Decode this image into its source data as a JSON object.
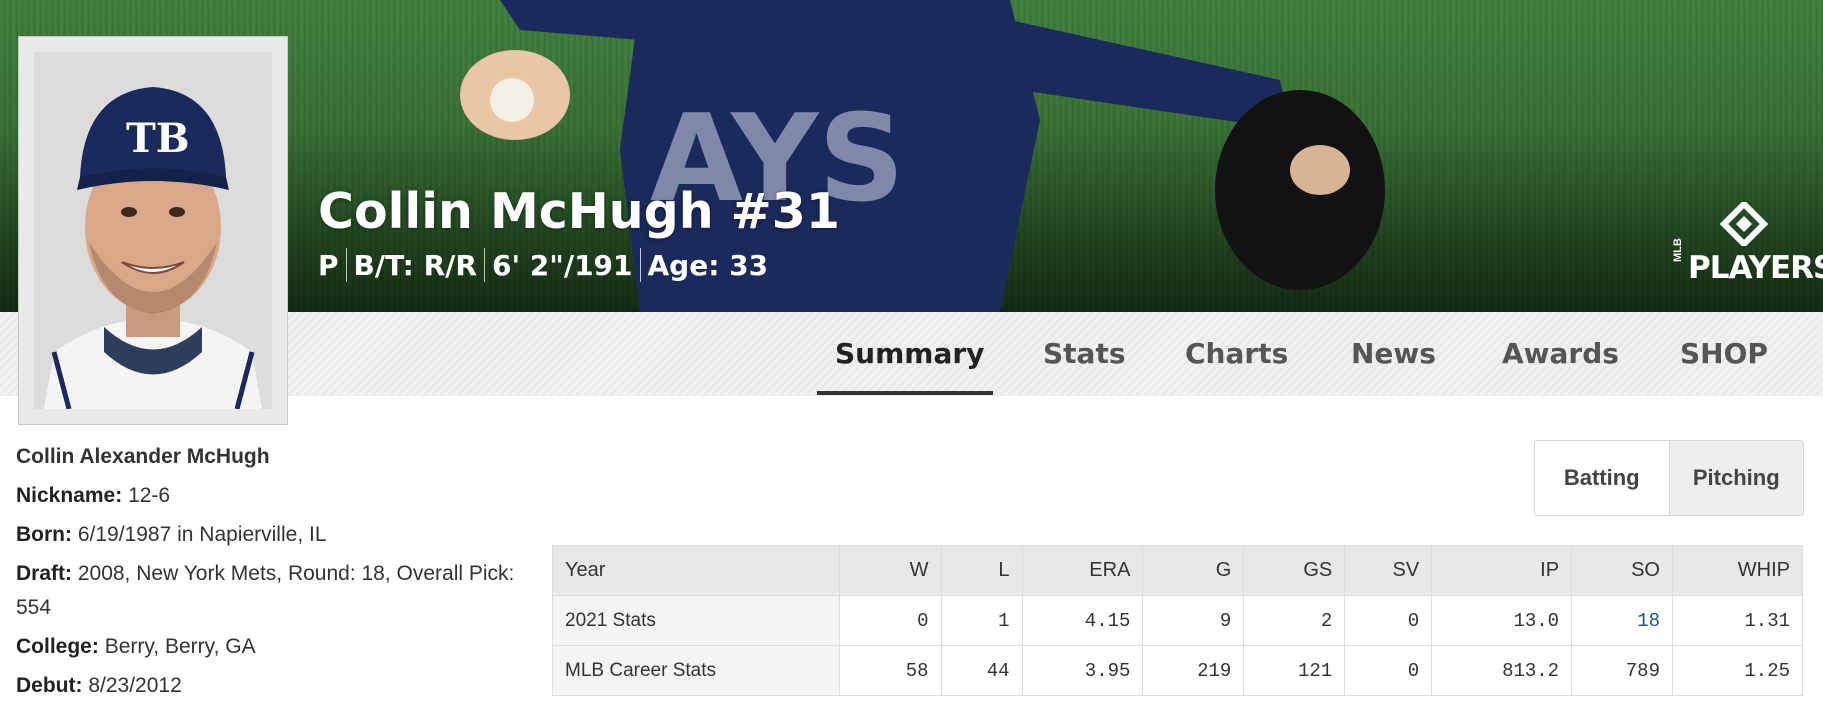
{
  "hero": {
    "name": "Collin McHugh #31",
    "vitals": [
      "P",
      "B/T: R/R",
      "6' 2\"/191",
      "Age: 33"
    ],
    "logo": {
      "small": "MLB",
      "main": "PLAYERS"
    }
  },
  "nav": {
    "tabs": [
      "Summary",
      "Stats",
      "Charts",
      "News",
      "Awards",
      "SHOP"
    ],
    "active": "Summary"
  },
  "bio": {
    "full_name": "Collin Alexander McHugh",
    "nickname_label": "Nickname:",
    "nickname": "12-6",
    "born_label": "Born:",
    "born": "6/19/1987 in Napierville, IL",
    "draft_label": "Draft:",
    "draft": "2008, New York Mets, Round: 18, Overall Pick: 554",
    "college_label": "College:",
    "college": "Berry, Berry, GA",
    "debut_label": "Debut:",
    "debut": "8/23/2012"
  },
  "toggle": {
    "batting": "Batting",
    "pitching": "Pitching",
    "selected": "Pitching"
  },
  "stats_table": {
    "columns": [
      "Year",
      "W",
      "L",
      "ERA",
      "G",
      "GS",
      "SV",
      "IP",
      "SO",
      "WHIP"
    ],
    "rows": [
      [
        "2021 Stats",
        "0",
        "1",
        "4.15",
        "9",
        "2",
        "0",
        "13.0",
        "18",
        "1.31"
      ],
      [
        "MLB Career Stats",
        "58",
        "44",
        "3.95",
        "219",
        "121",
        "0",
        "813.2",
        "789",
        "1.25"
      ]
    ]
  },
  "colors": {
    "field_green": "#3f7d3a",
    "jersey_navy": "#1b2a5c",
    "link_blue": "#1d4f8c"
  },
  "icons": [
    "mlb-players-logo-icon",
    "headshot-image"
  ]
}
